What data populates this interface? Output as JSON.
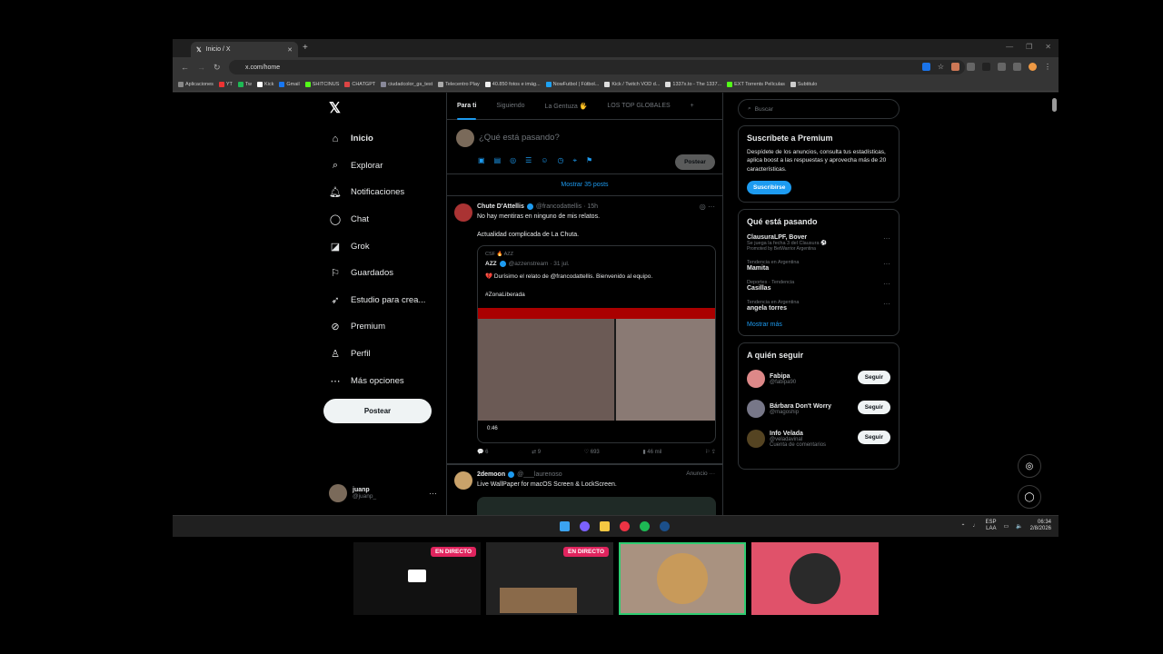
{
  "browser": {
    "tab_title": "Inicio / X",
    "url": "x.com/home"
  },
  "bookmarks": [
    "Aplicaciones",
    "YT",
    "Tw",
    "Kick",
    "Gmail",
    "SHITCINUS",
    "CHATGPT",
    "ciudadcolor_gs_test",
    "Telecentro Play",
    "40.850 fotos e imág...",
    "NowFutbol | Fútbol...",
    "Kick / Twitch VOD d...",
    "1337x.to - The 1337...",
    "EXT Torrents Películas",
    "Subtitulo"
  ],
  "sidebar": {
    "items": [
      {
        "label": "Inicio",
        "icon": "home-icon"
      },
      {
        "label": "Explorar",
        "icon": "search-icon"
      },
      {
        "label": "Notificaciones",
        "icon": "bell-icon"
      },
      {
        "label": "Chat",
        "icon": "chat-icon"
      },
      {
        "label": "Grok",
        "icon": "grok-icon"
      },
      {
        "label": "Guardados",
        "icon": "bookmark-icon"
      },
      {
        "label": "Estudio para crea...",
        "icon": "studio-icon"
      },
      {
        "label": "Premium",
        "icon": "premium-icon"
      },
      {
        "label": "Perfil",
        "icon": "profile-icon"
      },
      {
        "label": "Más opciones",
        "icon": "more-icon"
      }
    ],
    "post_button": "Postear",
    "user": {
      "name": "juanp",
      "handle": "@juanp_"
    }
  },
  "feed": {
    "tabs": [
      "Para ti",
      "Siguiendo",
      "La Gentuza 🖐",
      "LOS TOP GLOBALES"
    ],
    "compose_placeholder": "¿Qué está pasando?",
    "compose_post": "Postear",
    "show_posts": "Mostrar 35 posts",
    "tweet1": {
      "name": "Chute D'Attellis",
      "meta": "@francodattellis · 15h",
      "text1": "No hay mentiras en ninguno de mis relatos.",
      "text2": "Actualidad complicada de La Chuta.",
      "quote_context": "CSF 🔥 AZZ",
      "quote_name": "AZZ",
      "quote_meta": "@azzenstream · 31 jul.",
      "quote_text": "💔 Durísimo el relato de @francodattellis. Bienvenido al equipo.",
      "quote_tag": "#ZonaLiberada",
      "video_time": "0:46",
      "replies": "6",
      "retweets": "9",
      "likes": "693",
      "views": "46 mil"
    },
    "tweet2": {
      "name": "2demoon",
      "meta": "@___laurenoso",
      "ad": "Anuncio",
      "text": "Live WallPaper for macOS Screen & LockScreen."
    }
  },
  "right": {
    "search_placeholder": "Buscar",
    "premium": {
      "title": "Suscríbete a Premium",
      "text": "Despídete de los anuncios, consulta tus estadísticas, aplica boost a las respuestas y aprovecha más de 20 características.",
      "button": "Suscribirse"
    },
    "trends_title": "Qué está pasando",
    "trends": [
      {
        "name": "ClausuraLPF, Bover",
        "ctx": "Se juega la fecha 3 del Clausura ⚽",
        "promo": "Promoted by BetWarrior Argentina"
      },
      {
        "ctx": "Tendencia en Argentina",
        "name": "Mamita"
      },
      {
        "ctx": "Deportes · Tendencia",
        "name": "Casillas"
      },
      {
        "ctx": "Tendencia en Argentina",
        "name": "angela torres"
      }
    ],
    "show_more": "Mostrar más",
    "follow_title": "A quién seguir",
    "follow": [
      {
        "name": "Fabipa",
        "handle": "@fabipa90",
        "btn": "Seguir"
      },
      {
        "name": "Bárbara Don't Worry",
        "handle": "@magoship",
        "btn": "Seguir"
      },
      {
        "name": "Info Velada",
        "handle": "@veladavinal",
        "btn": "Seguir",
        "note": "Cuenta de comentarios"
      }
    ]
  },
  "taskbar": {
    "lang": "ESP",
    "lang2": "LAA",
    "time": "06:34",
    "date": "2/8/2026"
  },
  "stream": {
    "live": "EN DIRECTO"
  }
}
